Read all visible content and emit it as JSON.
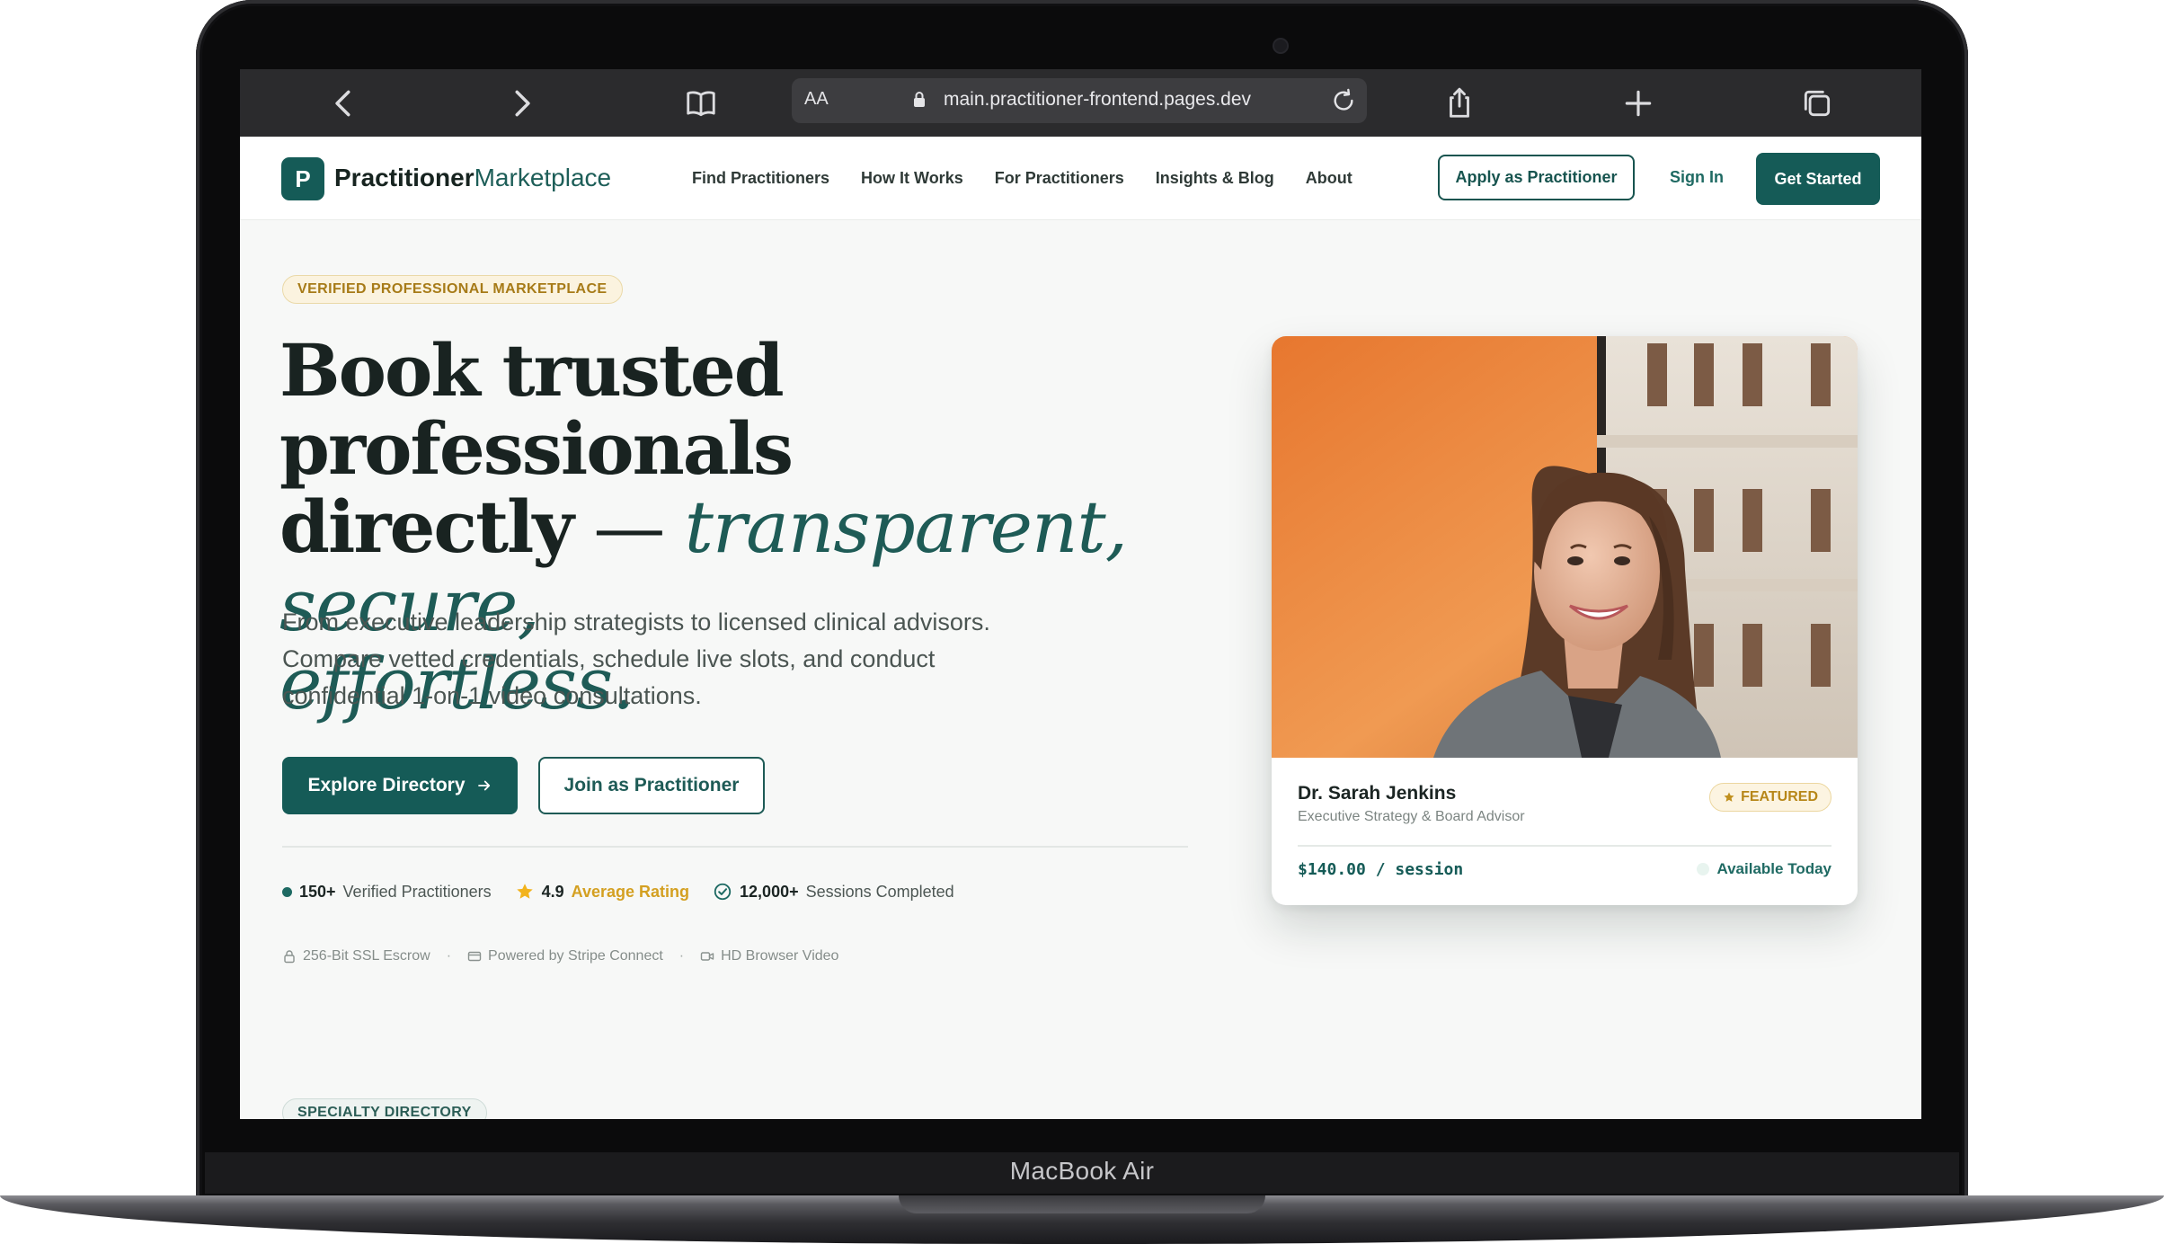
{
  "device": {
    "label": "MacBook Air"
  },
  "browser": {
    "text_size_label": "AA",
    "url": "main.practitioner-frontend.pages.dev",
    "icons": [
      "chevron-left-icon",
      "chevron-right-icon",
      "book-icon",
      "lock-icon",
      "reload-icon",
      "share-icon",
      "plus-icon",
      "tabs-icon"
    ]
  },
  "nav": {
    "logo_letter": "P",
    "logo_bold": "Practitioner",
    "logo_light": "Marketplace",
    "links": [
      "Find Practitioners",
      "How It Works",
      "For Practitioners",
      "Insights & Blog",
      "About"
    ],
    "apply_label": "Apply as Practitioner",
    "signin_label": "Sign In",
    "cta_label": "Get Started"
  },
  "hero": {
    "badge": "VERIFIED PROFESSIONAL MARKETPLACE",
    "headline_line1": "Book trusted professionals",
    "headline_line2_bold": "directly",
    "headline_dash": " — ",
    "headline_italic_1": "transparent, secure,",
    "headline_italic_2": "effortless.",
    "subtext": "From executive leadership strategists to licensed clinical advisors. Compare vetted credentials, schedule live slots, and conduct confidential 1-on-1 video consultations.",
    "primary_cta": "Explore Directory",
    "secondary_cta": "Join as Practitioner",
    "stats": {
      "practitioners_value": "150+",
      "practitioners_label": "Verified Practitioners",
      "rating_value": "4.9",
      "rating_label": "Average Rating",
      "sessions_value": "12,000+",
      "sessions_label": "Sessions Completed"
    },
    "trust": [
      "256-Bit SSL Escrow",
      "Powered by Stripe Connect",
      "HD Browser Video"
    ],
    "trust_separator": "·"
  },
  "profile_card": {
    "name": "Dr. Sarah Jenkins",
    "role": "Executive Strategy & Board Advisor",
    "featured_label": "FEATURED",
    "price": "$140.00 / session",
    "availability": "Available Today"
  },
  "next_section": {
    "badge": "SPECIALTY DIRECTORY"
  },
  "colors": {
    "brand": "#155b57",
    "accent_gold": "#d4a021",
    "page_bg": "#f7f8f7",
    "browser_chrome": "#2b2b2d"
  }
}
